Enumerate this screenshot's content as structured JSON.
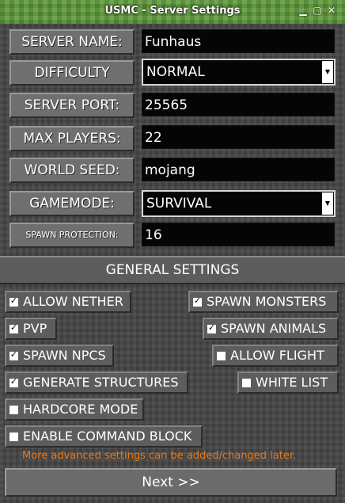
{
  "window": {
    "title": "USMC - Server Settings",
    "min_glyph": "▁",
    "max_glyph": "▢",
    "close_glyph": "✕"
  },
  "fields": {
    "server_name": {
      "label": "SERVER NAME:",
      "value": "Funhaus"
    },
    "difficulty": {
      "label": "DIFFICULTY",
      "value": "NORMAL"
    },
    "server_port": {
      "label": "SERVER PORT:",
      "value": "25565"
    },
    "max_players": {
      "label": "MAX PLAYERS:",
      "value": "22"
    },
    "world_seed": {
      "label": "WORLD SEED:",
      "value": "mojang"
    },
    "gamemode": {
      "label": "GAMEMODE:",
      "value": "SURVIVAL"
    },
    "spawn_protection": {
      "label": "SPAWN PROTECTION:",
      "value": "16"
    }
  },
  "general_settings": {
    "title": "GENERAL SETTINGS",
    "allow_nether": {
      "label": "ALLOW NETHER",
      "checked": true
    },
    "pvp": {
      "label": "PVP",
      "checked": true
    },
    "spawn_npcs": {
      "label": "SPAWN NPCS",
      "checked": true
    },
    "generate_structures": {
      "label": "GENERATE STRUCTURES",
      "checked": true
    },
    "hardcore_mode": {
      "label": "HARDCORE MODE",
      "checked": false
    },
    "enable_command_block": {
      "label": "ENABLE COMMAND BLOCK",
      "checked": false
    },
    "spawn_monsters": {
      "label": "SPAWN MONSTERS",
      "checked": true
    },
    "spawn_animals": {
      "label": "SPAWN ANIMALS",
      "checked": true
    },
    "allow_flight": {
      "label": "ALLOW FLIGHT",
      "checked": false
    },
    "white_list": {
      "label": "WHITE LIST",
      "checked": false
    }
  },
  "note": "More advanced settings can be added/changed later.",
  "next_label": "Next >>",
  "check_glyph": "✓",
  "dropdown_arrow_icon": "▼",
  "colors": {
    "accent_note": "#e87a1a",
    "title_grass": "#5e9a3a"
  }
}
